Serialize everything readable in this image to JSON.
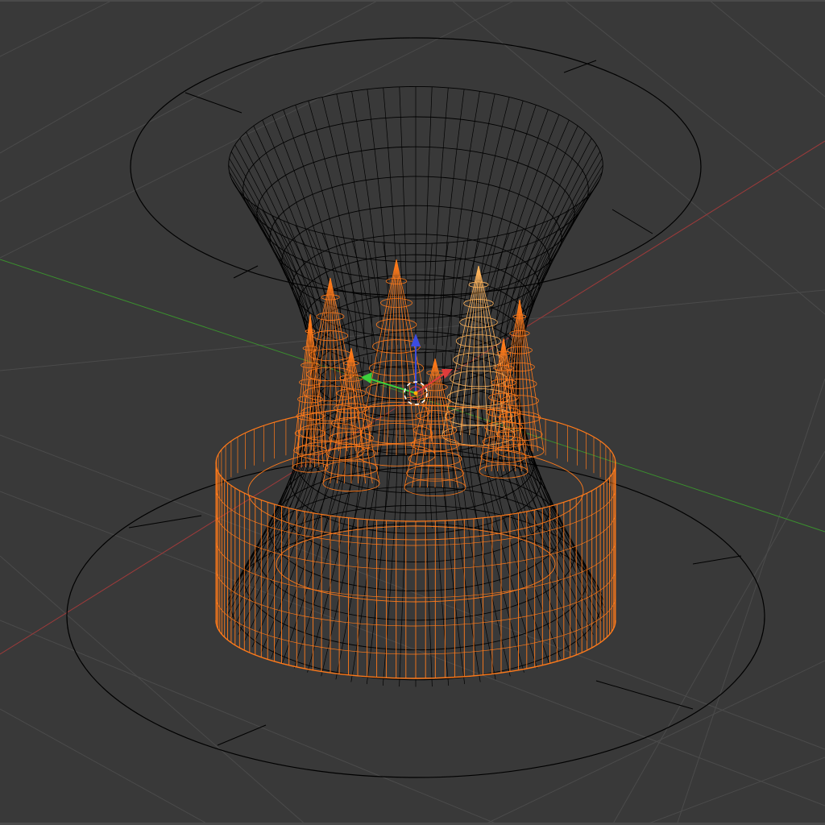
{
  "viewport": {
    "mode": "wireframe",
    "background": "#393939",
    "grid_color": "#4b4b4b",
    "x_axis_color": "#9c3a3a",
    "y_axis_color": "#3a8f2e",
    "wire_color": "#000000",
    "selected_color": "#ff7a1a",
    "active_color": "#ffb45c",
    "crown_spike_count": 8,
    "gizmo": {
      "x_color": "#e03c3c",
      "y_color": "#3ccf3c",
      "z_color": "#3c4ce0",
      "cursor_icon": "3d-cursor-icon"
    }
  }
}
